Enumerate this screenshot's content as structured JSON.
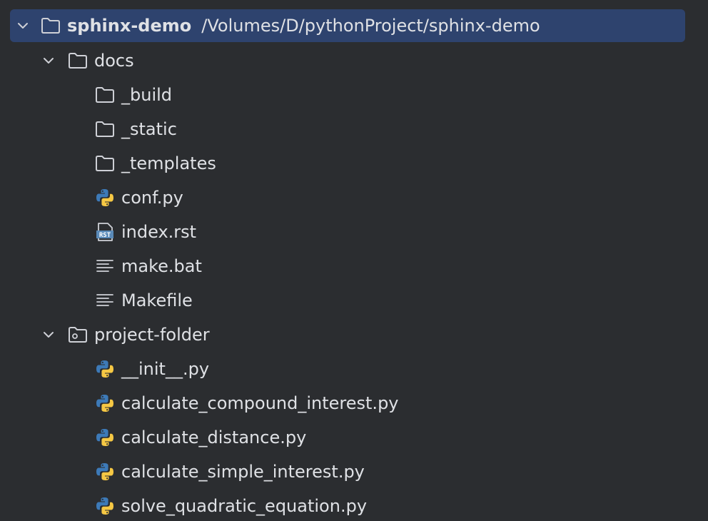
{
  "root": {
    "name": "sphinx-demo",
    "path": "/Volumes/D/pythonProject/sphinx-demo"
  },
  "docs": {
    "label": "docs",
    "children": [
      {
        "label": "_build",
        "icon": "folder-icon"
      },
      {
        "label": "_static",
        "icon": "folder-icon"
      },
      {
        "label": "_templates",
        "icon": "folder-icon"
      },
      {
        "label": "conf.py",
        "icon": "python-file-icon"
      },
      {
        "label": "index.rst",
        "icon": "rst-file-icon",
        "icon_text": "RST"
      },
      {
        "label": "make.bat",
        "icon": "text-file-icon"
      },
      {
        "label": "Makefile",
        "icon": "text-file-icon"
      }
    ]
  },
  "project_folder": {
    "label": "project-folder",
    "children": [
      {
        "label": "__init__.py",
        "icon": "python-file-icon"
      },
      {
        "label": "calculate_compound_interest.py",
        "icon": "python-file-icon"
      },
      {
        "label": "calculate_distance.py",
        "icon": "python-file-icon"
      },
      {
        "label": "calculate_simple_interest.py",
        "icon": "python-file-icon"
      },
      {
        "label": "solve_quadratic_equation.py",
        "icon": "python-file-icon"
      }
    ]
  },
  "colors": {
    "background": "#2b2d30",
    "selection": "#2e436e",
    "text": "#dfe1e5",
    "icon_stroke": "#ced0d6",
    "python_blue": "#3d7ab8",
    "python_yellow": "#f6c844",
    "rst_blue": "#5a8ab8"
  }
}
